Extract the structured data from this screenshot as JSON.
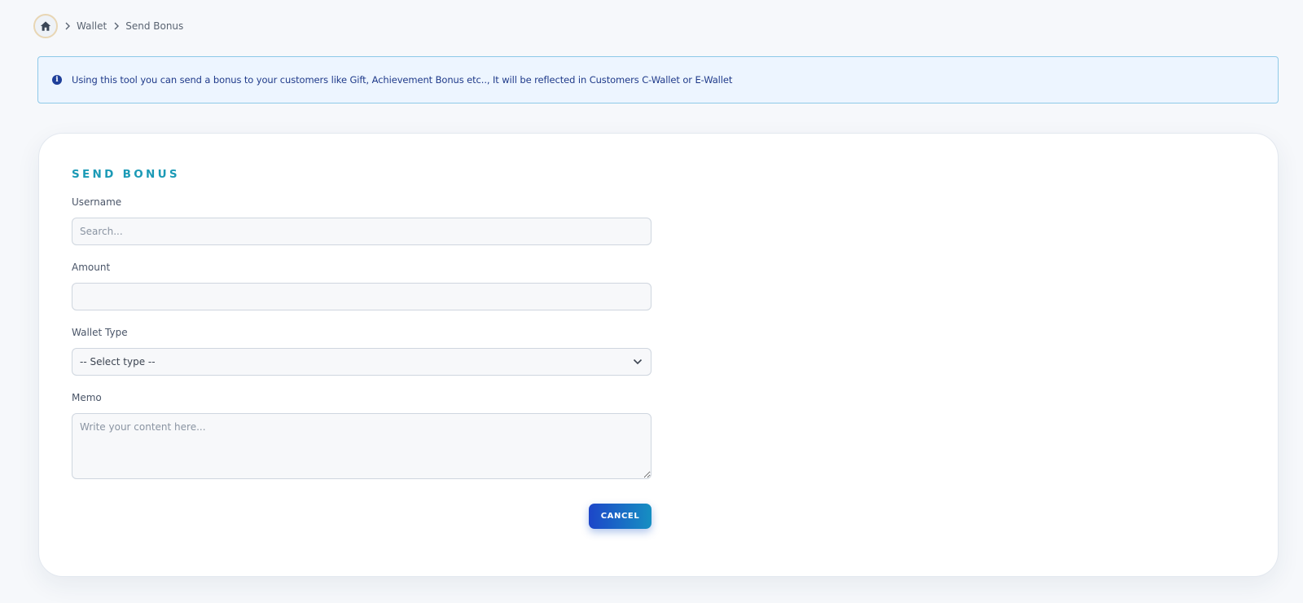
{
  "breadcrumb": {
    "home_icon": "home-icon",
    "items": [
      {
        "label": "Wallet"
      },
      {
        "label": "Send Bonus"
      }
    ]
  },
  "alert": {
    "icon": "info-icon",
    "text": "Using this tool you can send a bonus to your customers like Gift, Achievement Bonus etc.., It will be reflected in Customers C-Wallet or E-Wallet"
  },
  "form": {
    "title": "SEND BONUS",
    "username": {
      "label": "Username",
      "placeholder": "Search...",
      "value": ""
    },
    "amount": {
      "label": "Amount",
      "placeholder": "",
      "value": ""
    },
    "wallet_type": {
      "label": "Wallet Type",
      "selected": "-- Select type --"
    },
    "memo": {
      "label": "Memo",
      "placeholder": "Write your content here...",
      "value": ""
    },
    "cancel_label": "CANCEL"
  },
  "colors": {
    "accent_title": "#1b9ab6",
    "alert_text": "#1f3a8a",
    "button_start": "#1d46c9",
    "button_end": "#168fc2"
  }
}
